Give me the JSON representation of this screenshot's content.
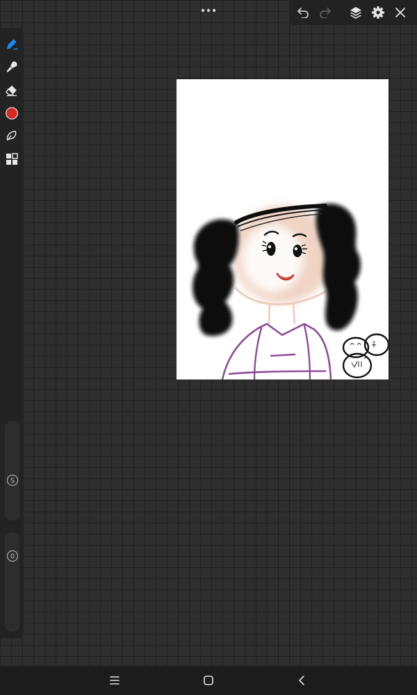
{
  "app": {
    "accent_color": "#1a8cff",
    "current_color": "#d12a27"
  },
  "top_bar": {
    "menu_icon": "more-horizontal-icon",
    "actions": [
      {
        "icon": "undo-icon"
      },
      {
        "icon": "redo-icon",
        "disabled": true
      },
      {
        "icon": "layers-icon"
      },
      {
        "icon": "settings-icon"
      },
      {
        "icon": "close-icon"
      }
    ]
  },
  "toolbar": {
    "tools": [
      {
        "icon": "pen-icon",
        "active": true
      },
      {
        "icon": "smudge-brush-icon"
      },
      {
        "icon": "eraser-icon"
      },
      {
        "icon": "color-swatch-icon",
        "color": "#d12a27"
      },
      {
        "icon": "lasso-icon"
      },
      {
        "icon": "layout-grid-icon"
      }
    ],
    "size_slider": {
      "label": "S"
    },
    "opacity_slider": {
      "label": "0"
    }
  },
  "nav": {
    "buttons": [
      {
        "icon": "recent-apps-icon"
      },
      {
        "icon": "home-icon"
      },
      {
        "icon": "back-icon"
      }
    ]
  }
}
